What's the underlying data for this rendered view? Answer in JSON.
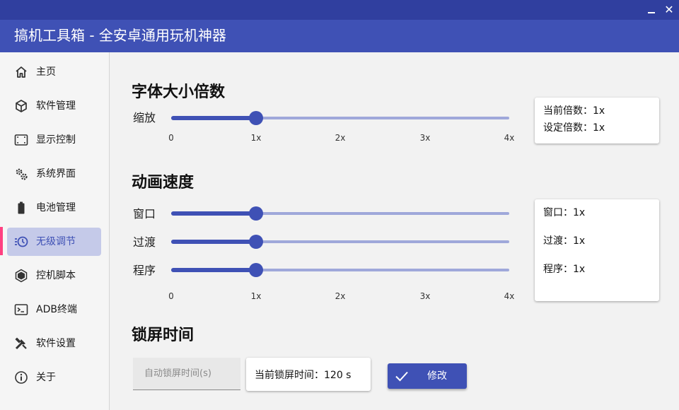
{
  "window": {
    "title": "搞机工具箱 - 全安卓通用玩机神器",
    "minimize_icon": "minimize-icon",
    "close_icon": "close-icon",
    "close_glyph": "✕"
  },
  "colors": {
    "primary": "#3f51b5",
    "primary_dark": "#303f9f",
    "rail": "#9fa8da",
    "active_bg": "#c5cae9",
    "active_marker": "#ff4081"
  },
  "sidebar": {
    "active_index": 5,
    "items": [
      {
        "label": "主页",
        "icon": "home-icon"
      },
      {
        "label": "软件管理",
        "icon": "package-icon"
      },
      {
        "label": "显示控制",
        "icon": "screen-frame-icon"
      },
      {
        "label": "系统界面",
        "icon": "gears-icon"
      },
      {
        "label": "电池管理",
        "icon": "battery-icon"
      },
      {
        "label": "无级调节",
        "icon": "clock-speed-icon"
      },
      {
        "label": "控机脚本",
        "icon": "hexagon-icon"
      },
      {
        "label": "ADB终端",
        "icon": "terminal-icon"
      },
      {
        "label": "软件设置",
        "icon": "tools-icon"
      },
      {
        "label": "关于",
        "icon": "info-icon"
      }
    ]
  },
  "font_scale": {
    "title": "字体大小倍数",
    "slider_label": "缩放",
    "ticks": [
      "0",
      "1x",
      "2x",
      "3x",
      "4x"
    ],
    "value": 1,
    "max": 4,
    "current_label": "当前倍数：1x",
    "set_label": "设定倍数：1x"
  },
  "animation": {
    "title": "动画速度",
    "ticks": [
      "0",
      "1x",
      "2x",
      "3x",
      "4x"
    ],
    "max": 4,
    "rows": [
      {
        "label": "窗口",
        "value": 1,
        "status": "窗口：1x"
      },
      {
        "label": "过渡",
        "value": 1,
        "status": "过渡：1x"
      },
      {
        "label": "程序",
        "value": 1,
        "status": "程序：1x"
      }
    ]
  },
  "lock_screen": {
    "title": "锁屏时间",
    "input_placeholder": "自动锁屏时间(s)",
    "current_text": "当前锁屏时间：120 s",
    "modify_label": "修改",
    "modify_icon": "check-icon"
  }
}
